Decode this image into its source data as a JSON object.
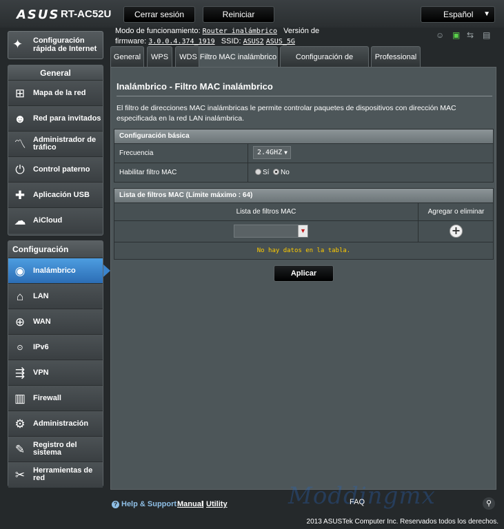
{
  "header": {
    "brand": "ASUS",
    "model": "RT-AC52U",
    "logout_label": "Cerrar sesión",
    "reboot_label": "Reiniciar",
    "language": "Español"
  },
  "info": {
    "mode_label": "Modo de funcionamiento:",
    "mode_value": "Router inalámbrico",
    "version_label": "Versión de firmware:",
    "firmware": "3.0.0.4.374_1919",
    "ssid_label": "SSID:",
    "ssid1": "ASUS2",
    "ssid2": "ASUS_5G"
  },
  "quick_setup": {
    "label": "Configuración rápida de Internet"
  },
  "sidebar": {
    "general_title": "General",
    "general_items": [
      {
        "label": "Mapa de la red",
        "icon": "network-map-icon"
      },
      {
        "label": "Red para invitados",
        "icon": "guest-network-icon"
      },
      {
        "label": "Administrador de tráfico",
        "icon": "traffic-manager-icon"
      },
      {
        "label": "Control paterno",
        "icon": "parental-control-icon"
      },
      {
        "label": "Aplicación USB",
        "icon": "usb-app-icon"
      },
      {
        "label": "AiCloud",
        "icon": "aicloud-icon"
      }
    ],
    "advanced_title": "Configuración avanzada",
    "advanced_items": [
      {
        "label": "Inalámbrico",
        "icon": "wireless-icon"
      },
      {
        "label": "LAN",
        "icon": "lan-icon"
      },
      {
        "label": "WAN",
        "icon": "wan-icon"
      },
      {
        "label": "IPv6",
        "icon": "ipv6-icon"
      },
      {
        "label": "VPN",
        "icon": "vpn-icon"
      },
      {
        "label": "Firewall",
        "icon": "firewall-icon"
      },
      {
        "label": "Administración",
        "icon": "administration-icon"
      },
      {
        "label": "Registro del sistema",
        "icon": "system-log-icon"
      },
      {
        "label": "Herramientas de red",
        "icon": "network-tools-icon"
      }
    ]
  },
  "tabs": [
    "General",
    "WPS",
    "WDS",
    "Filtro MAC inalámbrico",
    "Configuración de RADIUS",
    "Professional"
  ],
  "main": {
    "title": "Inalámbrico - Filtro MAC inalámbrico",
    "description": "El filtro de direcciones MAC inalámbricas le permite controlar paquetes de dispositivos con dirección MAC especificada en la red LAN inalámbrica.",
    "basic_header": "Configuración básica",
    "freq_label": "Frecuencia",
    "freq_value": "2.4GHZ",
    "enable_label": "Habilitar filtro MAC",
    "yes_label": "Sí",
    "no_label": "No",
    "list_header": "Lista de filtros MAC (Límite máximo : 64)",
    "col_list": "Lista de filtros MAC",
    "col_action": "Agregar o eliminar",
    "empty_text": "No hay datos en la tabla.",
    "apply_label": "Aplicar"
  },
  "footer": {
    "help": "Help & Support",
    "manual": "Manual",
    "separator": "|",
    "utility": "Utility",
    "faq": "FAQ",
    "watermark": "Moddingmx",
    "copyright": "2013 ASUSTek Computer Inc. Reservados todos los derechos."
  }
}
